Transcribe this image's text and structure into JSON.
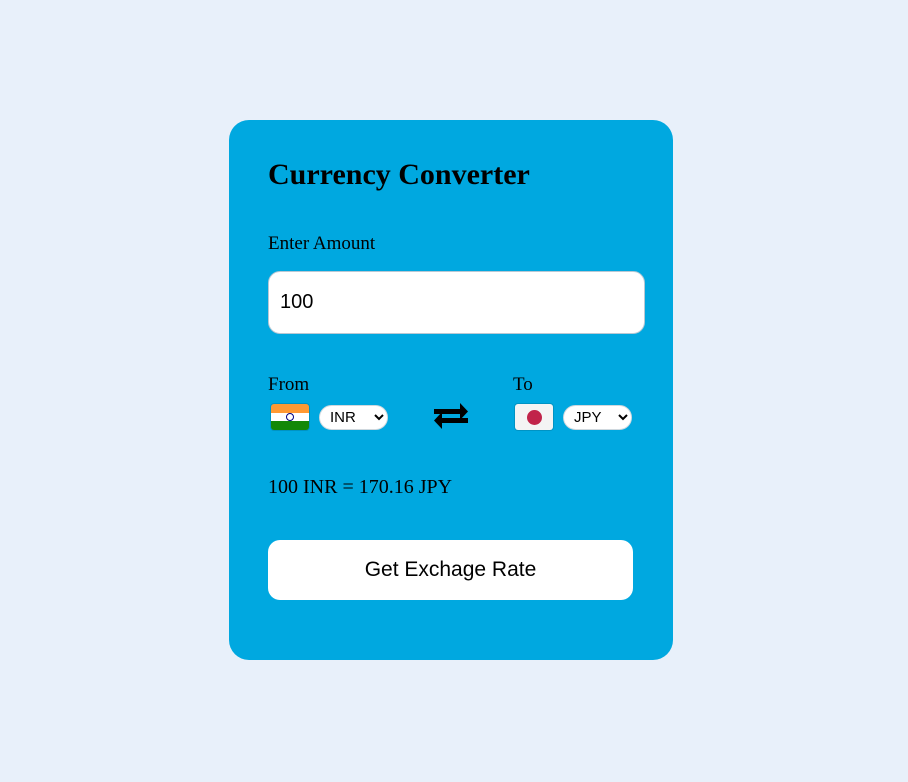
{
  "converter": {
    "title": "Currency Converter",
    "amount_label": "Enter Amount",
    "amount_value": "100",
    "from_label": "From",
    "to_label": "To",
    "from_currency": "INR",
    "to_currency": "JPY",
    "from_flag_icon": "india-flag-icon",
    "to_flag_icon": "japan-flag-icon",
    "swap_icon": "swap-arrows-icon",
    "result_text": "100 INR = 170.16 JPY",
    "button_label": "Get Exchage Rate"
  },
  "colors": {
    "page_background": "#e8f0fa",
    "card_background": "#00a8e0",
    "button_background": "#ffffff"
  }
}
